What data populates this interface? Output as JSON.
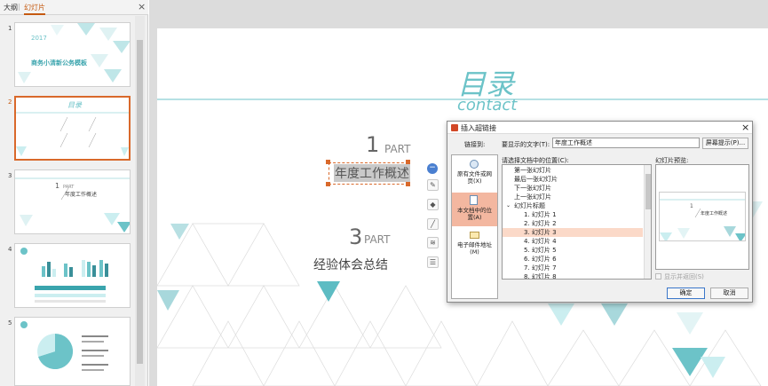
{
  "left_pane": {
    "tab_outline": "大纲",
    "tab_separator": "|",
    "tab_slides": "幻灯片",
    "close": "×",
    "thumb_numbers": [
      "1",
      "2",
      "3",
      "4",
      "5"
    ],
    "thumb1": {
      "year": "2017",
      "title": "商务小清新公务模板"
    },
    "thumb2": {
      "title": "目录"
    },
    "thumb3": {
      "number": "1",
      "part": "PART",
      "text": "年度工作概述"
    }
  },
  "slide": {
    "title": "目录",
    "subtitle": "contact",
    "part1_number": "1",
    "part1_label": "PART",
    "part1_text": "年度工作概述",
    "part3_number": "3",
    "part3_label": "PART",
    "part3_text": "经验体会总结"
  },
  "dialog": {
    "title": "插入超链接",
    "close": "×",
    "link_to": "链接到:",
    "display_text_label": "要显示的文字(T):",
    "display_text_value": "年度工作概述",
    "screentip_button": "屏幕提示(P)...",
    "place_label": "请选择文档中的位置(C):",
    "preview_label": "幻灯片预览:",
    "nav_items": [
      {
        "label": "原有文件或网页(X)",
        "icon": "globe-doc-icon"
      },
      {
        "label": "本文档中的位置(A)",
        "icon": "doc-place-icon"
      },
      {
        "label": "电子邮件地址(M)",
        "icon": "mail-icon"
      }
    ],
    "places": [
      "第一张幻灯片",
      "最后一张幻灯片",
      "下一张幻灯片",
      "上一张幻灯片",
      "幻灯片标题",
      "1. 幻灯片 1",
      "2. 幻灯片 2",
      "3. 幻灯片 3",
      "4. 幻灯片 4",
      "5. 幻灯片 5",
      "6. 幻灯片 6",
      "7. 幻灯片 7",
      "8. 幻灯片 8"
    ],
    "selected_place": "3. 幻灯片 3",
    "show_return_label": "显示并返回(S)",
    "ok": "确定",
    "cancel": "取消",
    "preview": {
      "number": "1",
      "text": "年度工作概述"
    }
  },
  "colors": {
    "accent": "#6cc3c8",
    "brand_orange": "#c55a11",
    "selection": "#fbd9c8"
  }
}
